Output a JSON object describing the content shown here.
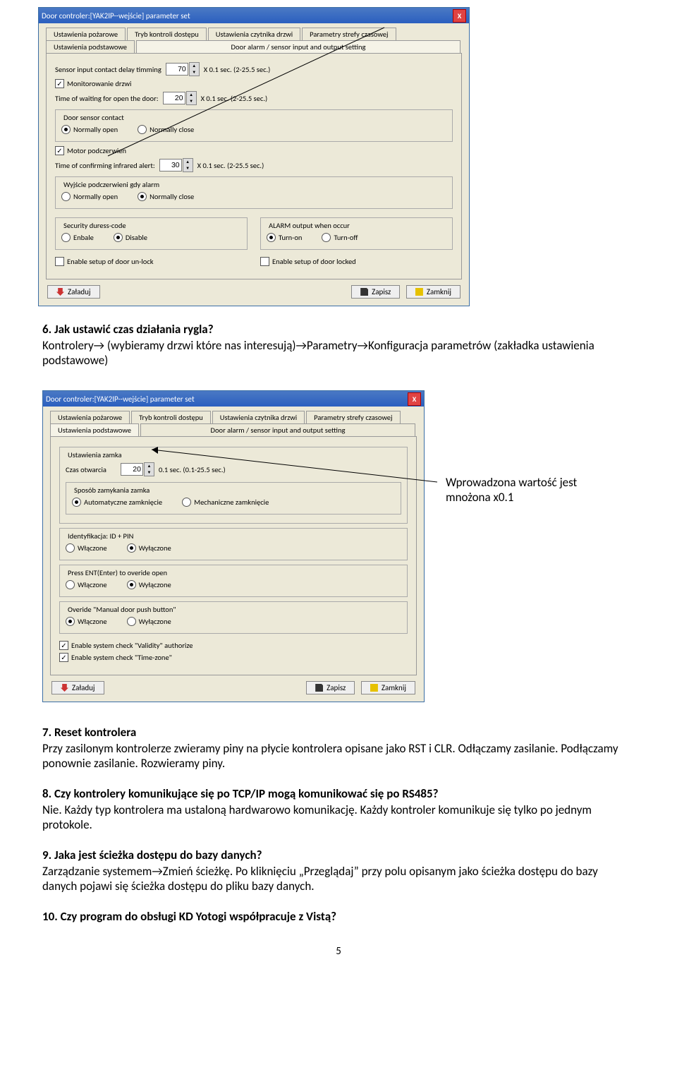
{
  "screenshot1": {
    "title": "Door controler:[YAK2IP--wejście] parameter set",
    "tabs_row1": [
      "Ustawienia pożarowe",
      "Tryb kontroli dostępu",
      "Ustawienia czytnika drzwi",
      "Parametry strefy czasowej"
    ],
    "tabs_row2": [
      "Ustawienia podstawowe",
      "Door alarm / sensor input and output setting"
    ],
    "sensor_label": "Sensor input contact delay timming",
    "sensor_val": "70",
    "sensor_after": "X 0.1 sec. (2-25.5 sec.)",
    "monitor": "Monitorowanie drzwi",
    "wait_label": "Time of waiting for open the door:",
    "wait_val": "20",
    "wait_after": "X 0.1 sec. (2-25.5 sec.)",
    "doorsensor_legend": "Door sensor contact",
    "normally_open": "Normally open",
    "normally_close": "Normally close",
    "pir": "Motor podczerwien",
    "confirm_label": "Time of confirming infrared alert:",
    "confirm_val": "30",
    "confirm_after": "X 0.1 sec. (2-25.5 sec.)",
    "pirout_legend": "Wyjście podczerwieni gdy alarm",
    "sec_legend": "Security duress-code",
    "sec_enable": "Enbale",
    "sec_disable": "Disable",
    "alarm_legend": "ALARM output when occur",
    "alarm_on": "Turn-on",
    "alarm_off": "Turn-off",
    "unlock": "Enable setup of door un-lock",
    "locked": "Enable setup of door locked",
    "btn_load": "Załaduj",
    "btn_save": "Zapisz",
    "btn_close": "Zamknij"
  },
  "q6": {
    "num": "6.",
    "title": "Jak ustawić czas działania rygla?",
    "body": "Kontrolery→ (wybieramy drzwi które nas interesują)→Parametry→Konfiguracja parametrów (zakładka ustawienia podstawowe)"
  },
  "screenshot2": {
    "title": "Door controler:[YAK2IP--wejście] parameter set",
    "tabs_row1": [
      "Ustawienia pożarowe",
      "Tryb kontroli dostępu",
      "Ustawienia czytnika drzwi",
      "Parametry strefy czasowej"
    ],
    "tabs_row2": [
      "Ustawienia podstawowe",
      "Door alarm / sensor input and output setting"
    ],
    "lock_legend": "Ustawienia zamka",
    "open_label": "Czas otwarcia",
    "open_val": "20",
    "open_after": "0.1 sec. (0.1-25.5 sec.)",
    "close_legend": "Sposób zamykania zamka",
    "auto": "Automatyczne zamknięcie",
    "mech": "Mechaniczne zamknięcie",
    "id_legend": "Identyfikacja: ID + PIN",
    "on": "Włączone",
    "off": "Wyłączone",
    "ent_legend": "Press ENT(Enter) to overide open",
    "manual_legend": "Overide \"Manual door push button\"",
    "chk_validity": "Enable system check \"Validity\" authorize",
    "chk_timezone": "Enable system check \"Time-zone\"",
    "btn_load": "Załaduj",
    "btn_save": "Zapisz",
    "btn_close": "Zamknij"
  },
  "note": "Wprowadzona wartość jest mnożona x0.1",
  "q7": {
    "num": "7.",
    "title": "Reset kontrolera",
    "body": "Przy zasilonym  kontrolerze zwieramy piny na płycie kontrolera opisane jako RST i CLR. Odłączamy zasilanie. Podłączamy ponownie zasilanie. Rozwieramy piny."
  },
  "q8": {
    "num": "8.",
    "title": "Czy kontrolery komunikujące się po TCP/IP mogą komunikować się po RS485?",
    "body": "Nie. Każdy typ kontrolera ma ustaloną hardwarowo komunikację. Każdy kontroler komunikuje się tylko po jednym protokole."
  },
  "q9": {
    "num": "9.",
    "title": "Jaka jest ścieżka dostępu do bazy danych?",
    "body": "Zarządzanie systemem→Zmień ścieżkę. Po kliknięciu „Przeglądaj” przy polu opisanym jako ścieżka dostępu do bazy danych pojawi się ścieżka dostępu do pliku bazy danych."
  },
  "q10": {
    "num": "10.",
    "title": "Czy program do obsługi KD Yotogi współpracuje z Vistą?"
  },
  "pagenum": "5"
}
